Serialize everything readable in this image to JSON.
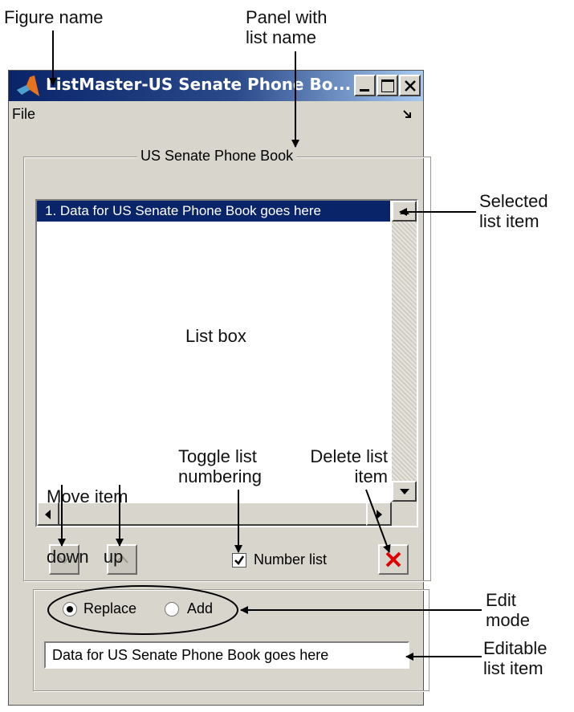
{
  "annotations": {
    "figure_name": "Figure name",
    "panel_with_list_name": [
      "Panel with",
      "list name"
    ],
    "selected_list_item": [
      "Selected",
      "list item"
    ],
    "list_box": "List box",
    "move_item": [
      "Move item",
      "down   up"
    ],
    "toggle_list_numbering": [
      "Toggle list",
      "numbering"
    ],
    "delete_list_item": [
      "Delete list",
      "item"
    ],
    "edit_mode": [
      "Edit",
      "mode"
    ],
    "editable_list_item": [
      "Editable",
      "list item"
    ]
  },
  "window": {
    "title": "ListMaster-US Senate Phone Bo...",
    "menu_file": "File",
    "panel_title": "US Senate Phone Book",
    "selected_item": "1. Data for US Senate Phone Book goes here",
    "number_list_label": "Number list",
    "number_list_checked": true,
    "radio_replace": "Replace",
    "radio_add": "Add",
    "edit_mode_selected": "Replace",
    "edit_value": "Data for US Senate Phone Book goes here"
  },
  "colors": {
    "title_bar": "#0a246a",
    "selection": "#0a246a",
    "delete_icon": "#e00000",
    "window_bg": "#d8d5cc"
  }
}
